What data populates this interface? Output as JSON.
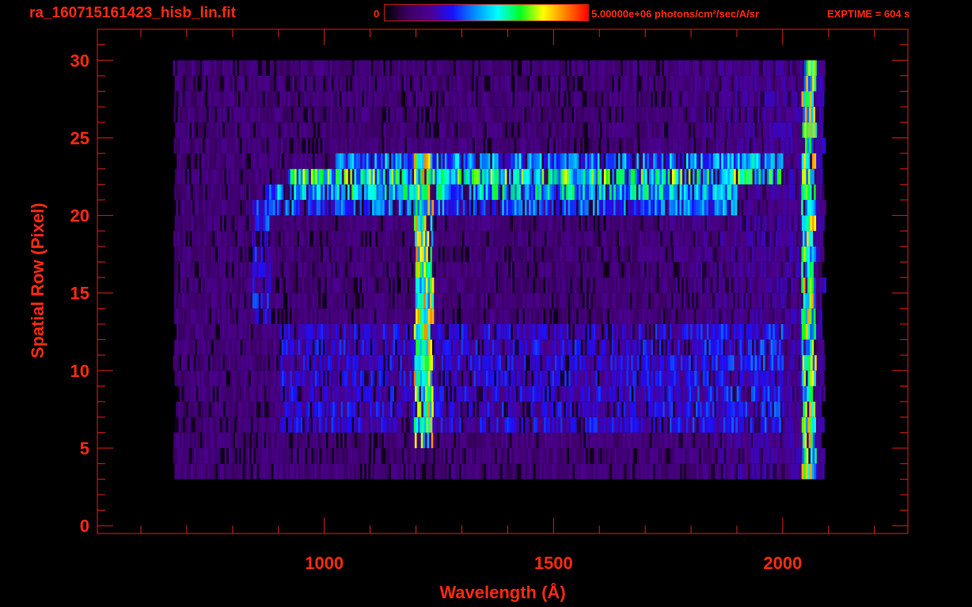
{
  "chart_data": {
    "type": "heatmap",
    "title": "ra_160715161423_hisb_lin.fit",
    "xlabel": "Wavelength (Å)",
    "ylabel": "Spatial Row (Pixel)",
    "xlim": [
      505,
      2273
    ],
    "ylim": [
      -0.5,
      32
    ],
    "xticks": [
      1000,
      1500,
      2000
    ],
    "xtick_labels": [
      "1000",
      "1500",
      "2000"
    ],
    "yticks": [
      0,
      5,
      10,
      15,
      20,
      25,
      30
    ],
    "ytick_labels": [
      "0",
      "5",
      "10",
      "15",
      "20",
      "25",
      "30"
    ],
    "colorbar": {
      "min_label": "0",
      "max_label": "5.00000e+06 photons/cm²/sec/A/sr",
      "min": 0,
      "max": 5000000,
      "colormap": [
        "#000000",
        "#3a0060",
        "#4b0090",
        "#1a10ff",
        "#0090ff",
        "#00ffff",
        "#00ff20",
        "#ffff00",
        "#ff8000",
        "#ff0000"
      ]
    },
    "exptime": "EXPTIME = 604 s",
    "grid": false,
    "features": [
      {
        "name": "background",
        "rows": [
          3,
          29
        ],
        "wavelength": [
          670,
          2090
        ],
        "level": 0.18
      },
      {
        "name": "band-row-23",
        "rows": [
          23,
          23
        ],
        "wavelength": [
          1020,
          2000
        ],
        "level": 0.45
      },
      {
        "name": "band-row-22",
        "rows": [
          22,
          22
        ],
        "wavelength": [
          920,
          2000
        ],
        "level": 0.62
      },
      {
        "name": "band-row-21",
        "rows": [
          21,
          21
        ],
        "wavelength": [
          870,
          1900
        ],
        "level": 0.55
      },
      {
        "name": "band-row-20",
        "rows": [
          20,
          20
        ],
        "wavelength": [
          880,
          1900
        ],
        "level": 0.4
      },
      {
        "name": "band-rows-6-12",
        "rows": [
          6,
          12
        ],
        "wavelength": [
          900,
          2000
        ],
        "level": 0.3
      },
      {
        "name": "lyman-alpha",
        "rows": [
          5,
          23
        ],
        "wavelength": [
          1195,
          1235
        ],
        "level": 0.72
      },
      {
        "name": "edge",
        "rows": [
          2,
          29
        ],
        "wavelength": [
          2040,
          2070
        ],
        "level": 0.7
      },
      {
        "name": "arc",
        "rows": [
          13,
          20
        ],
        "wavelength": [
          840,
          880
        ],
        "level": 0.35
      }
    ]
  }
}
